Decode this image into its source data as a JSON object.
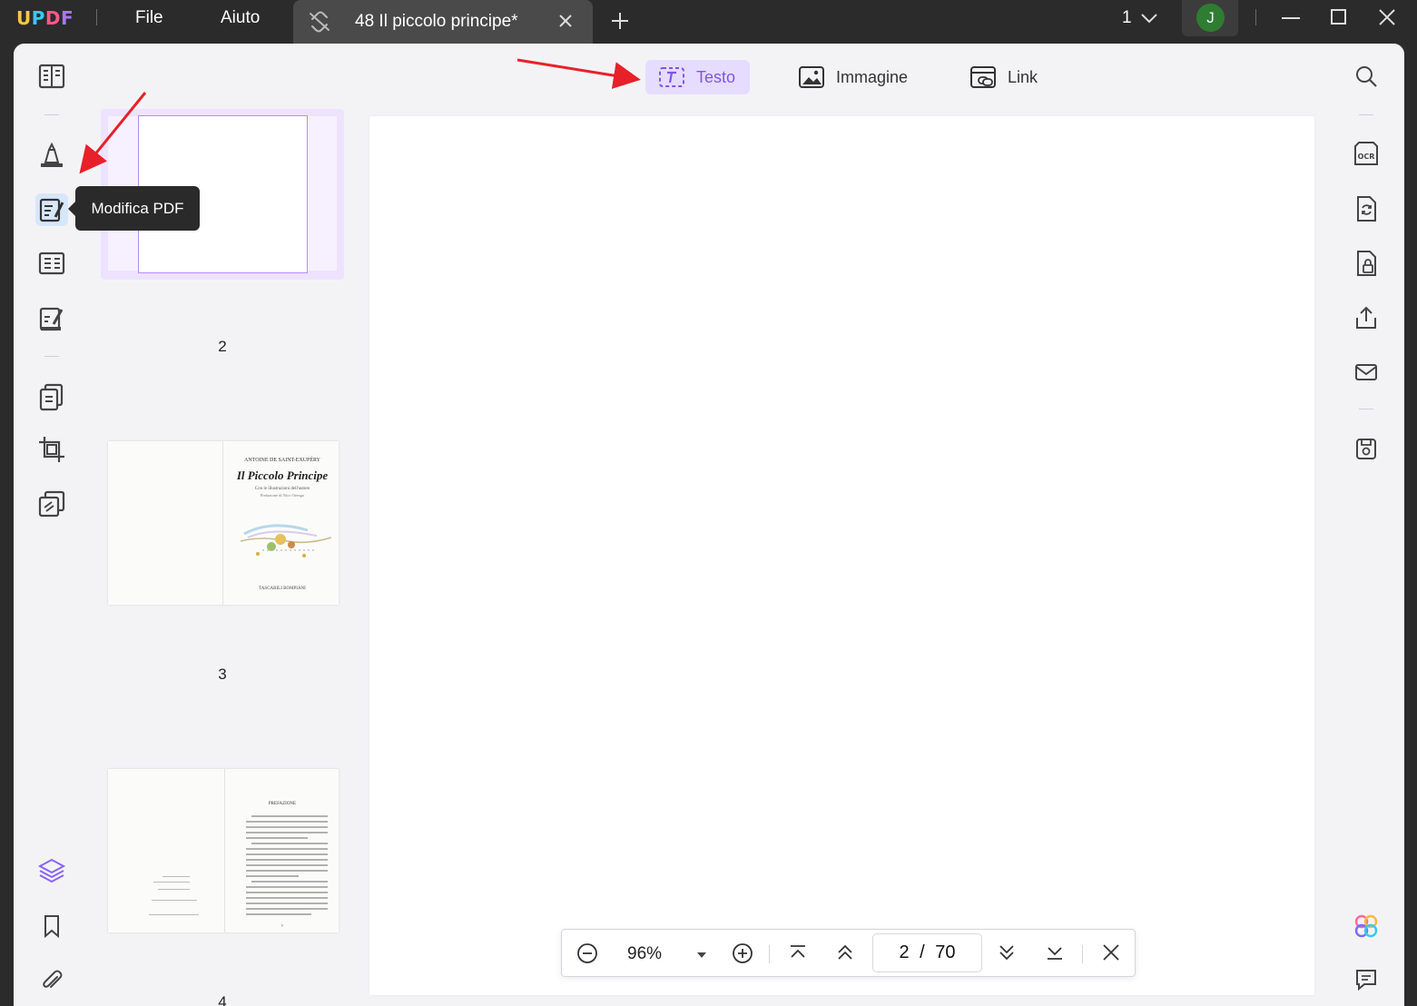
{
  "titlebar": {
    "logo": {
      "u": "U",
      "p": "P",
      "d": "D",
      "f": "F"
    },
    "menu": [
      "File",
      "Aiuto"
    ],
    "tab_title": "48 Il piccolo principe*",
    "page_selector": "1",
    "avatar_initial": "J"
  },
  "tooltip": "Modifica PDF",
  "edit_toolbar": {
    "text_label": "Testo",
    "image_label": "Immagine",
    "link_label": "Link"
  },
  "thumbnails": [
    {
      "label": "2"
    },
    {
      "label": "3",
      "author": "ANTOINE DE SAINT-EXUPÉRY",
      "book_title": "Il Piccolo Principe",
      "subtitle": "Con le illustrazioni dell'autore",
      "translator": "Prefazione di Nico Orengo",
      "publisher": "TASCABILI BOMPIANI"
    },
    {
      "label": "4",
      "heading": "PREFAZIONE",
      "roman": "V"
    }
  ],
  "zoom_bar": {
    "zoom": "96%",
    "current_page": "2",
    "separator": "/",
    "total_pages": "70"
  },
  "colors": {
    "accent": "#7f56e5",
    "accent_bg": "#e6dcff",
    "annotation": "#e8202a"
  }
}
